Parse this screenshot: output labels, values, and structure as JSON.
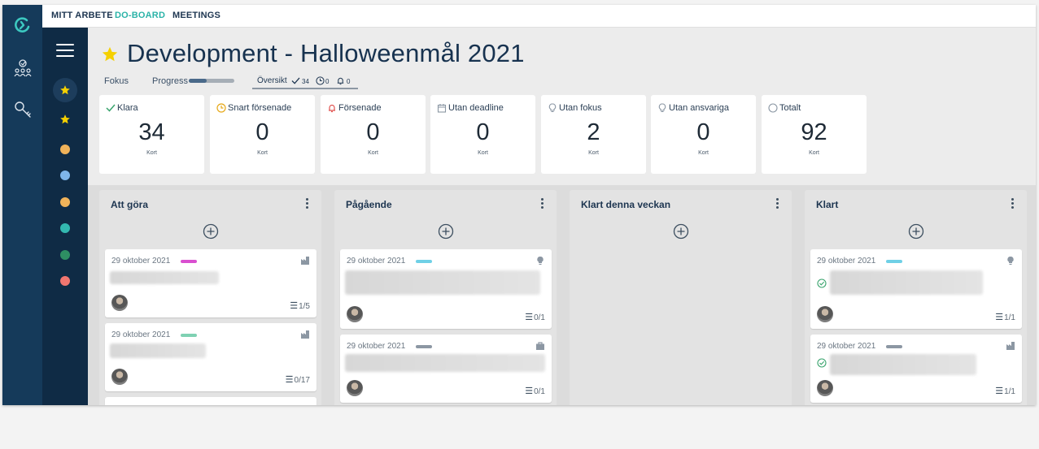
{
  "nav": {
    "items": [
      "MITT ARBETE",
      "DO-BOARD",
      "MEETINGS"
    ],
    "active": "DO-BOARD"
  },
  "header": {
    "title": "Development - Halloweenmål 2021",
    "tabs": {
      "fokus": "Fokus",
      "progress": "Progress",
      "oversikt": "Översikt"
    },
    "progress_fraction": 0.4,
    "oversikt_done": "34",
    "oversikt_soon": "0",
    "oversikt_alerts": "0"
  },
  "stats": [
    {
      "label": "Klara",
      "value": "34",
      "unit": "Kort",
      "icon": "check-icon",
      "color": "#3aa46e"
    },
    {
      "label": "Snart försenade",
      "value": "0",
      "unit": "Kort",
      "icon": "clock-icon",
      "color": "#e6a817"
    },
    {
      "label": "Försenade",
      "value": "0",
      "unit": "Kort",
      "icon": "bell-icon",
      "color": "#e0524f"
    },
    {
      "label": "Utan deadline",
      "value": "0",
      "unit": "Kort",
      "icon": "calendar-icon",
      "color": "#8a96a3"
    },
    {
      "label": "Utan fokus",
      "value": "2",
      "unit": "Kort",
      "icon": "lightbulb-icon",
      "color": "#8a96a3"
    },
    {
      "label": "Utan ansvariga",
      "value": "0",
      "unit": "Kort",
      "icon": "person-icon",
      "color": "#8a96a3"
    },
    {
      "label": "Totalt",
      "value": "92",
      "unit": "Kort",
      "icon": "circle-icon",
      "color": "#8a96a3"
    }
  ],
  "sidebar": {
    "dots": [
      "#f0b35a",
      "#7fb6ea",
      "#f0b35a",
      "#33b8b0",
      "#2e8f63",
      "#f07670"
    ],
    "star_color": "#f5d000"
  },
  "columns": [
    {
      "title": "Att göra",
      "cards": [
        {
          "date": "29 oktober 2021",
          "tag": "#d94fd0",
          "icon": "factory-icon",
          "checks": "1/5"
        },
        {
          "date": "29 oktober 2021",
          "tag": "#7fd1b3",
          "icon": "factory-icon",
          "checks": "0/17"
        }
      ]
    },
    {
      "title": "Pågående",
      "cards": [
        {
          "date": "29 oktober 2021",
          "tag": "#6fd0e6",
          "icon": "lightbulb-icon",
          "checks": "0/1"
        },
        {
          "date": "29 oktober 2021",
          "tag": "#8c97a3",
          "icon": "briefcase-icon",
          "checks": "0/1"
        }
      ]
    },
    {
      "title": "Klart denna veckan",
      "cards": []
    },
    {
      "title": "Klart",
      "cards": [
        {
          "date": "29 oktober 2021",
          "tag": "#6fd0e6",
          "icon": "lightbulb-icon",
          "checks": "1/1"
        },
        {
          "date": "29 oktober 2021",
          "tag": "#8c97a3",
          "icon": "factory-icon",
          "checks": "1/1"
        }
      ]
    }
  ]
}
